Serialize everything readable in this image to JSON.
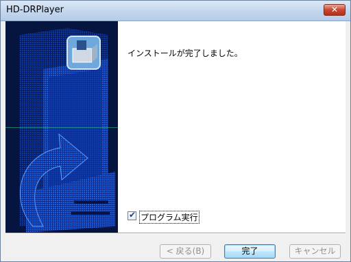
{
  "window": {
    "title": "HD-DRPlayer",
    "close_glyph": "✕"
  },
  "content": {
    "message": "インストールが完了しました。"
  },
  "option": {
    "label": "プログラム実行",
    "checked": true,
    "check_glyph": "✔"
  },
  "buttons": {
    "back": "< 戻る(B)",
    "finish": "完了",
    "cancel": "キャンセル"
  },
  "colors": {
    "banner_bg": "#061440",
    "banner_accent": "#1f6ae0",
    "title_close": "#c9442f"
  },
  "icons": {
    "installer": "installer-box-icon",
    "close": "close-icon",
    "check": "check-icon"
  }
}
